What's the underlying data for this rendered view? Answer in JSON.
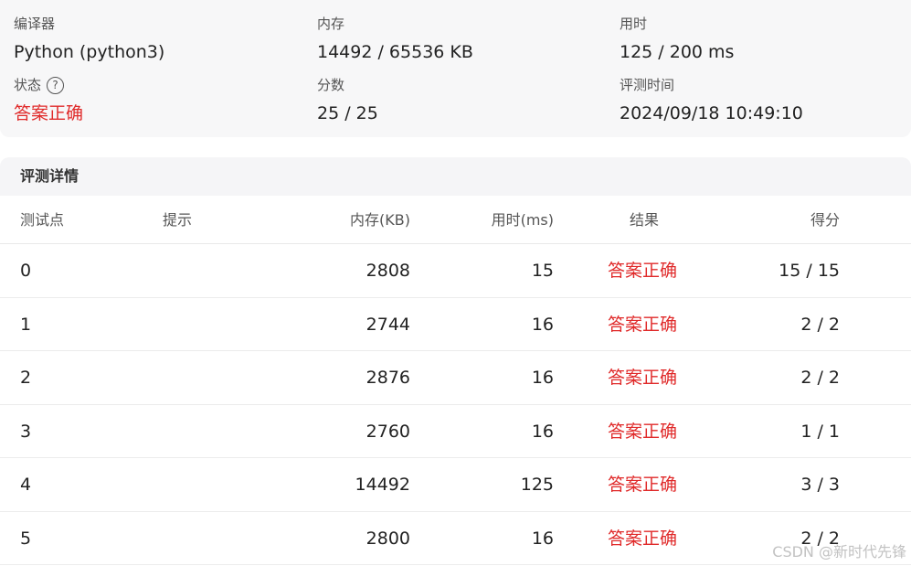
{
  "summary": {
    "compiler_label": "编译器",
    "compiler_value": "Python (python3)",
    "memory_label": "内存",
    "memory_value": "14492 / 65536 KB",
    "time_label": "用时",
    "time_value": "125 / 200 ms",
    "status_label": "状态",
    "status_help_icon": "question-circle-icon",
    "status_value": "答案正确",
    "score_label": "分数",
    "score_value": "25 / 25",
    "judge_time_label": "评测时间",
    "judge_time_value": "2024/09/18 10:49:10"
  },
  "details": {
    "title": "评测详情",
    "columns": {
      "point": "测试点",
      "hint": "提示",
      "memory": "内存(KB)",
      "time": "用时(ms)",
      "result": "结果",
      "score": "得分"
    },
    "rows": [
      {
        "point": "0",
        "hint": "",
        "memory": "2808",
        "time": "15",
        "result": "答案正确",
        "score": "15 / 15"
      },
      {
        "point": "1",
        "hint": "",
        "memory": "2744",
        "time": "16",
        "result": "答案正确",
        "score": "2 / 2"
      },
      {
        "point": "2",
        "hint": "",
        "memory": "2876",
        "time": "16",
        "result": "答案正确",
        "score": "2 / 2"
      },
      {
        "point": "3",
        "hint": "",
        "memory": "2760",
        "time": "16",
        "result": "答案正确",
        "score": "1 / 1"
      },
      {
        "point": "4",
        "hint": "",
        "memory": "14492",
        "time": "125",
        "result": "答案正确",
        "score": "3 / 3"
      },
      {
        "point": "5",
        "hint": "",
        "memory": "2800",
        "time": "16",
        "result": "答案正确",
        "score": "2 / 2"
      }
    ]
  },
  "watermark": "CSDN @新时代先锋",
  "colors": {
    "accepted": "#e02a2a",
    "panel_bg": "#f7f7f8"
  }
}
